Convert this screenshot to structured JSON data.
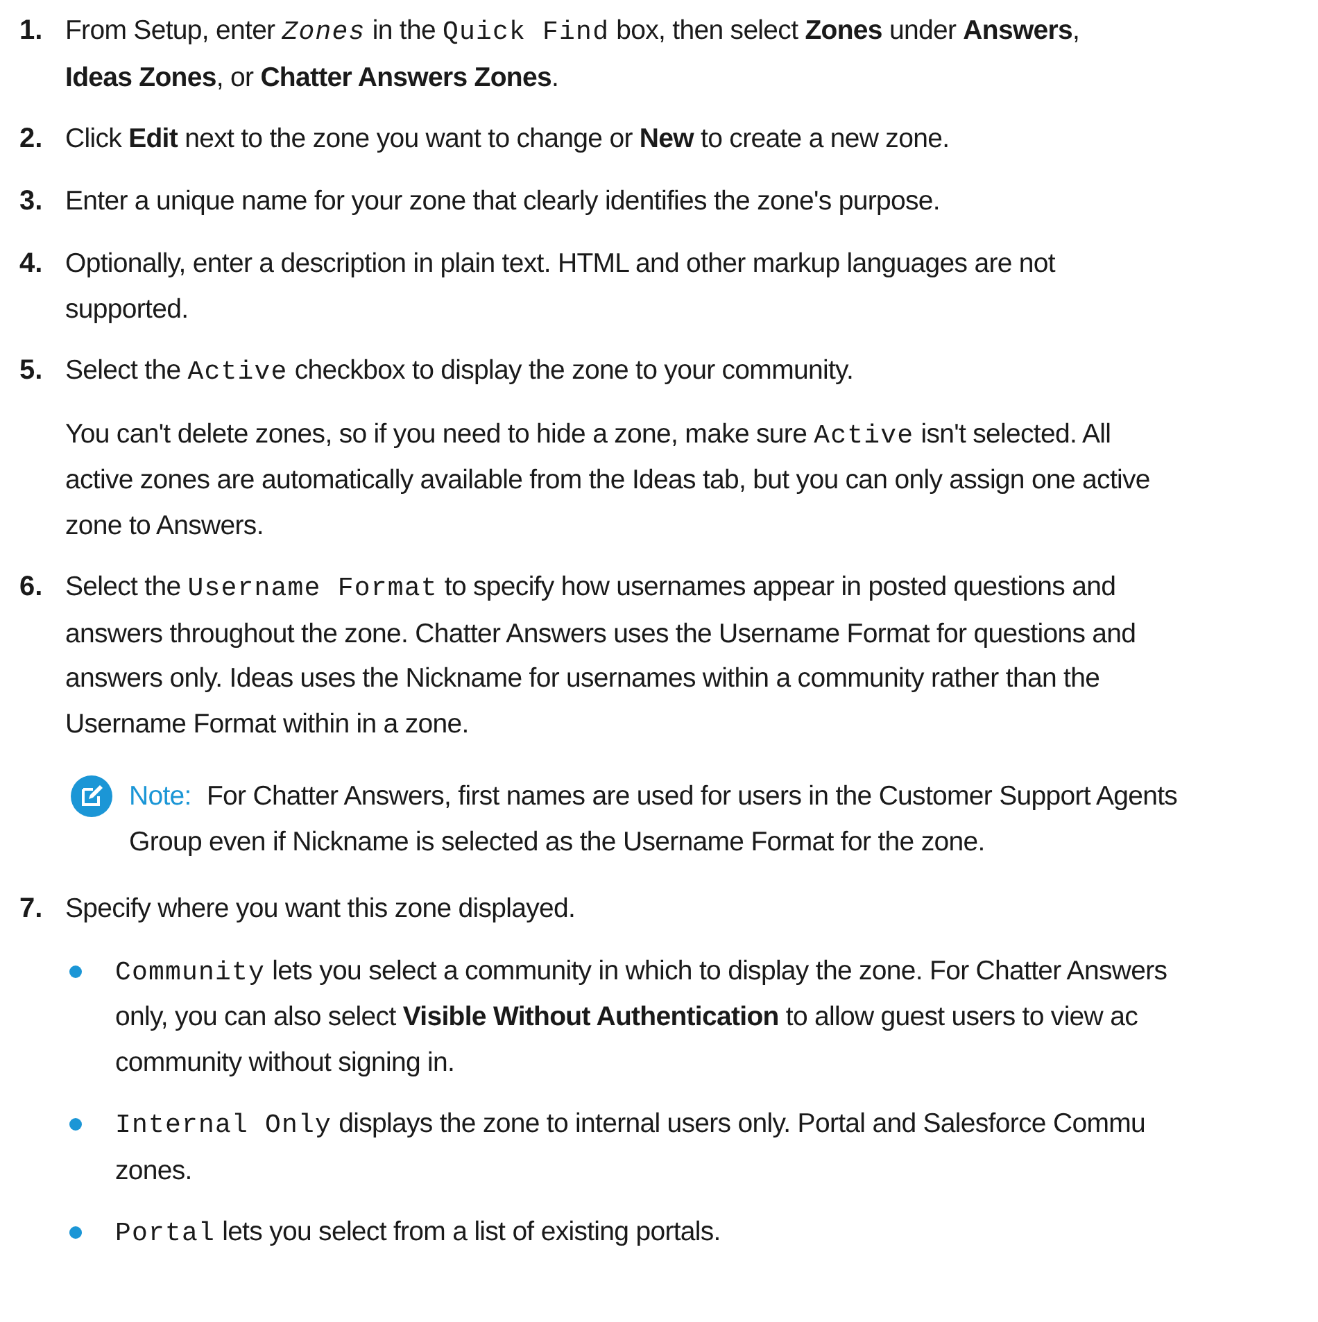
{
  "steps": [
    {
      "number": "1.",
      "paragraphs": [
        {
          "lines": [
            [
              {
                "kind": "text",
                "text": "From Setup, enter "
              },
              {
                "kind": "code_italic",
                "text": "Zones"
              },
              {
                "kind": "text",
                "text": " in the "
              },
              {
                "kind": "code",
                "text": "Quick Find"
              },
              {
                "kind": "text",
                "text": " box, then select **Zones** under **Answers**,"
              }
            ],
            [
              {
                "kind": "text",
                "text": "**Ideas Zones**, or **Chatter Answers Zones**."
              }
            ]
          ]
        }
      ]
    },
    {
      "number": "2.",
      "paragraphs": [
        {
          "lines": [
            [
              {
                "kind": "text",
                "text": "Click **Edit** next to the zone you want to change or **New** to create a new zone."
              }
            ]
          ]
        }
      ]
    },
    {
      "number": "3.",
      "paragraphs": [
        {
          "lines": [
            [
              {
                "kind": "text",
                "text": "Enter a unique name for your zone that clearly identifies the zone's purpose."
              }
            ]
          ]
        }
      ]
    },
    {
      "number": "4.",
      "paragraphs": [
        {
          "lines": [
            [
              {
                "kind": "text",
                "text": "Optionally, enter a description in plain text. HTML and other markup languages are not"
              }
            ],
            [
              {
                "kind": "text",
                "text": "supported."
              }
            ]
          ]
        }
      ]
    },
    {
      "number": "5.",
      "paragraphs": [
        {
          "lines": [
            [
              {
                "kind": "text",
                "text": "Select the "
              },
              {
                "kind": "code",
                "text": "Active"
              },
              {
                "kind": "text",
                "text": " checkbox to display the zone to your community."
              }
            ]
          ]
        },
        {
          "lines": [
            [
              {
                "kind": "text",
                "text": "You can't delete zones, so if you need to hide a zone, make sure "
              },
              {
                "kind": "code",
                "text": "Active"
              },
              {
                "kind": "text",
                "text": " isn't selected. All"
              }
            ],
            [
              {
                "kind": "text",
                "text": "active zones are automatically available from the Ideas tab, but you can only assign one active"
              }
            ],
            [
              {
                "kind": "text",
                "text": "zone to Answers."
              }
            ]
          ]
        }
      ]
    },
    {
      "number": "6.",
      "paragraphs": [
        {
          "lines": [
            [
              {
                "kind": "text",
                "text": "Select the "
              },
              {
                "kind": "code",
                "text": "Username Format"
              },
              {
                "kind": "text",
                "text": " to specify how usernames appear in posted questions and"
              }
            ],
            [
              {
                "kind": "text",
                "text": "answers throughout the zone. Chatter Answers uses the Username Format for questions and"
              }
            ],
            [
              {
                "kind": "text",
                "text": "answers only. Ideas uses the Nickname for usernames within a community rather than the"
              }
            ],
            [
              {
                "kind": "text",
                "text": "Username Format within in a zone."
              }
            ]
          ]
        }
      ],
      "note": {
        "label": "Note:",
        "lines": [
          [
            {
              "kind": "text",
              "text": "For Chatter Answers, first names are used for users in the Customer Support Agents"
            }
          ],
          [
            {
              "kind": "text",
              "text": "Group even if Nickname is selected as the Username Format for the zone."
            }
          ]
        ]
      }
    },
    {
      "number": "7.",
      "paragraphs": [
        {
          "lines": [
            [
              {
                "kind": "text",
                "text": "Specify where you want this zone displayed."
              }
            ]
          ]
        }
      ],
      "bullets": [
        {
          "lines": [
            [
              {
                "kind": "code",
                "text": "Community"
              },
              {
                "kind": "text",
                "text": " lets you select a community in which to display the zone. For Chatter Answers"
              }
            ],
            [
              {
                "kind": "text",
                "text": "only, you can also select **Visible Without Authentication** to allow guest users to view ac"
              }
            ],
            [
              {
                "kind": "text",
                "text": "community without signing in."
              }
            ]
          ]
        },
        {
          "lines": [
            [
              {
                "kind": "code",
                "text": "Internal Only"
              },
              {
                "kind": "text",
                "text": " displays the zone to internal users only. Portal and Salesforce Commu"
              }
            ],
            [
              {
                "kind": "text",
                "text": "zones."
              }
            ]
          ]
        },
        {
          "lines": [
            [
              {
                "kind": "code",
                "text": "Portal"
              },
              {
                "kind": "text",
                "text": " lets you select from a list of existing portals."
              }
            ]
          ]
        }
      ]
    }
  ]
}
